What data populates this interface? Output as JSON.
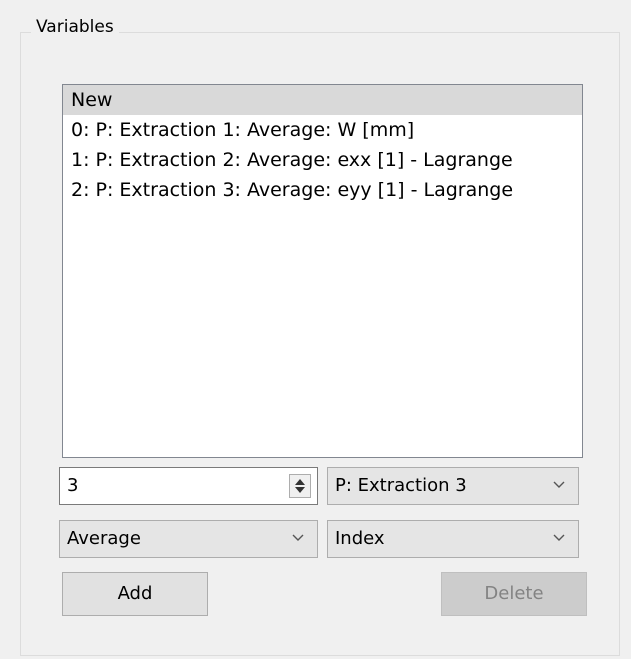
{
  "group": {
    "title": "Variables"
  },
  "list": {
    "items": [
      "New",
      "0: P: Extraction 1: Average: W [mm]",
      "1: P: Extraction 2: Average: exx [1] - Lagrange",
      "2: P: Extraction 3: Average: eyy [1] - Lagrange"
    ],
    "selected_index": 0
  },
  "controls": {
    "index_value": "3",
    "source_select": "P: Extraction 3",
    "operation_select": "Average",
    "axis_select": "Index",
    "add_label": "Add",
    "delete_label": "Delete"
  },
  "icons": {
    "spin": "spin-up-down-icon",
    "dropdown": "chevron-down-icon"
  },
  "colors": {
    "selected_row": "#d9d9d9",
    "window_bg": "#f0f0f0",
    "disabled_button": "#cccccc"
  }
}
